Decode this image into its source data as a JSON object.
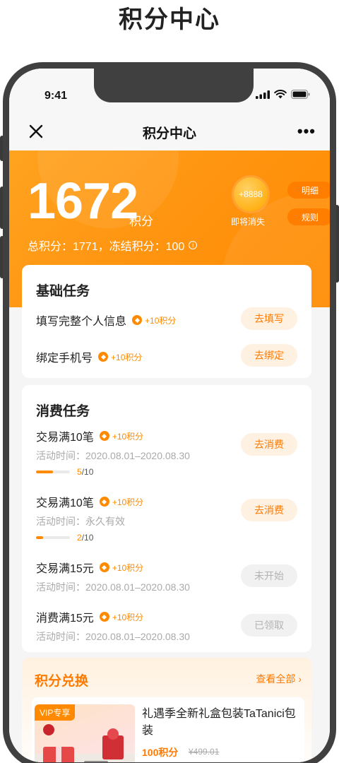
{
  "page_heading": "积分中心",
  "status": {
    "time": "9:41"
  },
  "nav": {
    "title": "积分中心"
  },
  "points": {
    "value": "1672",
    "unit": "积分",
    "detail": "总积分：1771，冻结积分：100",
    "expiring_value": "+8888",
    "expiring_label": "即将消失",
    "detail_button": "明细",
    "rules_button": "规则"
  },
  "basic_tasks": {
    "title": "基础任务",
    "items": [
      {
        "name": "填写完整个人信息",
        "reward": "+10积分",
        "button": "去填写"
      },
      {
        "name": "绑定手机号",
        "reward": "+10积分",
        "button": "去绑定"
      }
    ]
  },
  "consume_tasks": {
    "title": "消费任务",
    "items": [
      {
        "name": "交易满10笔",
        "reward": "+10积分",
        "time": "活动时间：2020.08.01–2020.08.30",
        "progress_current": "5",
        "progress_total": "/10",
        "progress_fraction": 0.5,
        "button": "去消费",
        "enabled": true
      },
      {
        "name": "交易满10笔",
        "reward": "+10积分",
        "time": "活动时间：永久有效",
        "progress_current": "2",
        "progress_total": "/10",
        "progress_fraction": 0.2,
        "button": "去消费",
        "enabled": true
      },
      {
        "name": "交易满15元",
        "reward": "+10积分",
        "time": "活动时间：2020.08.01–2020.08.30",
        "button": "未开始",
        "enabled": false
      },
      {
        "name": "消费满15元",
        "reward": "+10积分",
        "time": "活动时间：2020.08.01–2020.08.30",
        "button": "已领取",
        "enabled": false
      }
    ]
  },
  "exchange": {
    "title": "积分兑换",
    "view_all": "查看全部",
    "product": {
      "tag": "VIP专享",
      "name": "礼遇季全新礼盒包装TaTanici包装",
      "price": "100积分",
      "original_price": "¥499.01"
    }
  },
  "colors": {
    "accent": "#ff8a00",
    "hero": "#ff9410",
    "button_bg": "#fff1e2",
    "disabled_bg": "#f1f1f1"
  }
}
